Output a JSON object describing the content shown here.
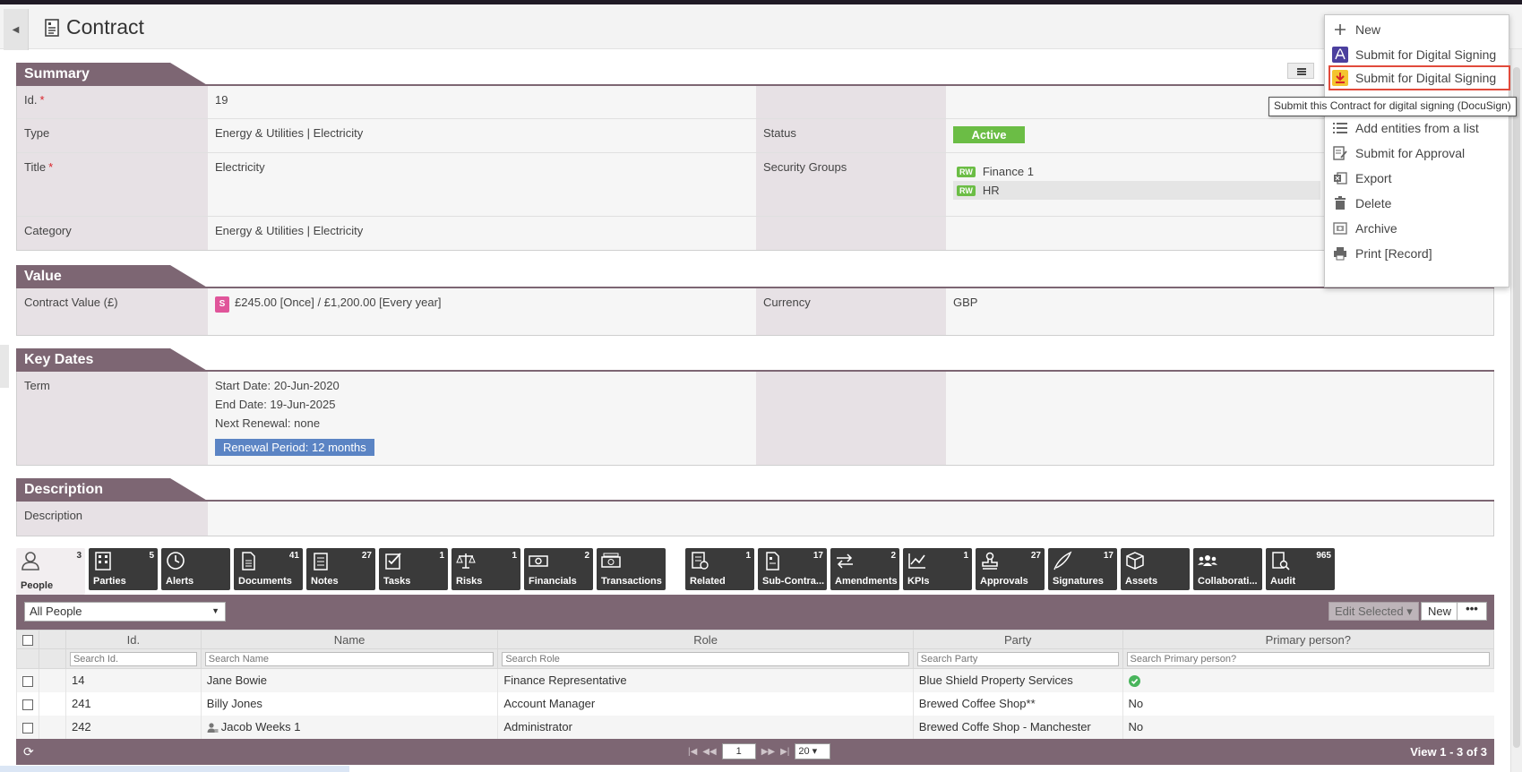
{
  "header": {
    "title": "Contract"
  },
  "summary": {
    "heading": "Summary",
    "id_label": "Id.",
    "id_value": "19",
    "type_label": "Type",
    "type_value": "Energy & Utilities | Electricity",
    "status_label": "Status",
    "status_value": "Active",
    "title_label": "Title",
    "title_value": "Electricity",
    "security_label": "Security Groups",
    "security_groups": [
      {
        "badge": "RW",
        "name": "Finance 1"
      },
      {
        "badge": "RW",
        "name": "HR"
      }
    ],
    "category_label": "Category",
    "category_value": "Energy & Utilities | Electricity",
    "required_mark": "*"
  },
  "value_section": {
    "heading": "Value",
    "contract_value_label": "Contract Value (£)",
    "contract_value_icon": "S",
    "contract_value": "£245.00 [Once] / £1,200.00 [Every year]",
    "currency_label": "Currency",
    "currency_value": "GBP"
  },
  "key_dates": {
    "heading": "Key Dates",
    "term_label": "Term",
    "start": "Start Date: 20-Jun-2020",
    "end": "End Date: 19-Jun-2025",
    "renewal": "Next Renewal: none",
    "renewal_period": "Renewal Period: 12 months"
  },
  "description": {
    "heading": "Description",
    "label": "Description"
  },
  "tabs": [
    {
      "label": "People",
      "count": "3",
      "icon": "person-icon"
    },
    {
      "label": "Parties",
      "count": "5",
      "icon": "building-icon"
    },
    {
      "label": "Alerts",
      "count": "",
      "icon": "clock-icon"
    },
    {
      "label": "Documents",
      "count": "41",
      "icon": "document-icon"
    },
    {
      "label": "Notes",
      "count": "27",
      "icon": "notepad-icon"
    },
    {
      "label": "Tasks",
      "count": "1",
      "icon": "tasks-icon"
    },
    {
      "label": "Risks",
      "count": "1",
      "icon": "scales-icon"
    },
    {
      "label": "Financials",
      "count": "2",
      "icon": "banknote-icon"
    },
    {
      "label": "Transactions",
      "count": "",
      "icon": "transactions-icon"
    },
    {
      "label": "Related",
      "count": "1",
      "icon": "related-icon"
    },
    {
      "label": "Sub-Contra...",
      "count": "17",
      "icon": "subcontract-icon"
    },
    {
      "label": "Amendments",
      "count": "2",
      "icon": "arrows-icon"
    },
    {
      "label": "KPIs",
      "count": "1",
      "icon": "chart-icon"
    },
    {
      "label": "Approvals",
      "count": "27",
      "icon": "stamp-icon"
    },
    {
      "label": "Signatures",
      "count": "17",
      "icon": "quill-icon"
    },
    {
      "label": "Assets",
      "count": "",
      "icon": "box-icon"
    },
    {
      "label": "Collaborati...",
      "count": "",
      "icon": "group-icon"
    },
    {
      "label": "Audit",
      "count": "965",
      "icon": "audit-icon"
    }
  ],
  "grid": {
    "filter_value": "All People",
    "edit_selected": "Edit Selected",
    "new_label": "New",
    "more_label": "•••",
    "columns": [
      "Id.",
      "Name",
      "Role",
      "Party",
      "Primary person?"
    ],
    "placeholders": [
      "Search Id.",
      "Search Name",
      "Search Role",
      "Search Party",
      "Search Primary person?"
    ],
    "rows": [
      {
        "id": "14",
        "name": "Jane Bowie",
        "role": "Finance Representative",
        "party": "Blue Shield Property Services",
        "primary": ""
      },
      {
        "id": "241",
        "name": "Billy Jones",
        "role": "Account Manager",
        "party": "Brewed Coffee Shop**",
        "primary": "No"
      },
      {
        "id": "242",
        "name": "Jacob Weeks 1",
        "role": "Administrator",
        "party": "Brewed Coffe Shop - Manchester",
        "primary": "No"
      }
    ],
    "page": "1",
    "page_size": "20",
    "view_info": "View 1 - 3 of 3"
  },
  "menu": {
    "items": [
      {
        "label": "New",
        "icon": "plus-icon"
      },
      {
        "label": "Submit for Digital Signing",
        "icon": "adobe-sign-icon"
      },
      {
        "label": "Submit for Digital Signing",
        "icon": "docusign-icon"
      },
      {
        "label": "Add entities from a list",
        "icon": "list-icon"
      },
      {
        "label": "Submit for Approval",
        "icon": "approval-icon"
      },
      {
        "label": "Export",
        "icon": "excel-icon"
      },
      {
        "label": "Delete",
        "icon": "trash-icon"
      },
      {
        "label": "Archive",
        "icon": "archive-icon"
      },
      {
        "label": "Print [Record]",
        "icon": "print-icon"
      }
    ],
    "tooltip": "Submit this Contract for digital signing (DocuSign)"
  },
  "colors": {
    "section_header": "#7d6673",
    "active_badge": "#6bbd45",
    "renewal_badge": "#5b84c4",
    "highlight_outline": "#e14a3b"
  }
}
